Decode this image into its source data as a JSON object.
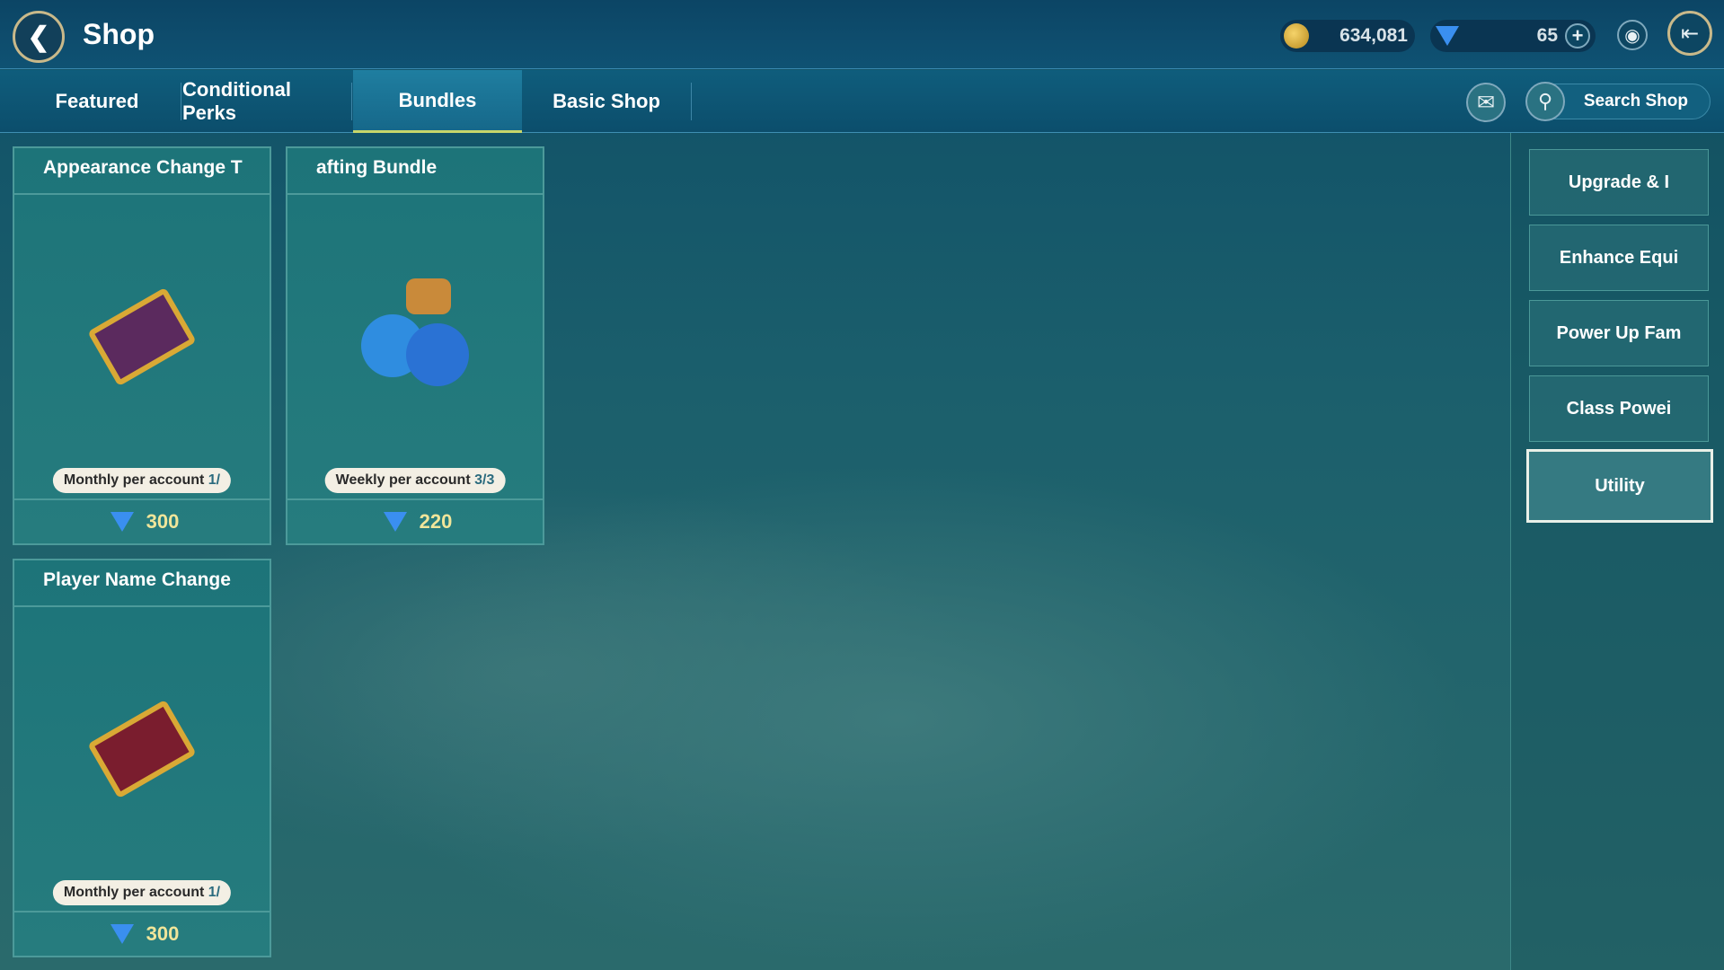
{
  "header": {
    "title": "Shop",
    "gold": "634,081",
    "gems": "65"
  },
  "tabs": [
    {
      "label": "Featured"
    },
    {
      "label": "Conditional Perks"
    },
    {
      "label": "Bundles",
      "active": true
    },
    {
      "label": "Basic Shop"
    }
  ],
  "search": {
    "placeholder": "Search Shop"
  },
  "items": [
    {
      "title": "Appearance Change T",
      "limit_label": "Monthly per account",
      "limit_count": "1/",
      "price": "300"
    },
    {
      "title": "afting Bundle",
      "limit_label": "Weekly per account",
      "limit_count": "3/3",
      "price": "220"
    },
    {
      "title": "Player Name Change",
      "limit_label": "Monthly per account",
      "limit_count": "1/",
      "price": "300"
    }
  ],
  "categories": [
    {
      "label": "Upgrade & I"
    },
    {
      "label": "Enhance Equi"
    },
    {
      "label": "Power Up Fam"
    },
    {
      "label": "Class Powei"
    },
    {
      "label": "Utility",
      "active": true
    }
  ],
  "colors": {
    "accent": "#c8d66a",
    "price": "#f0e59a",
    "gem": "#3a8ff0"
  }
}
